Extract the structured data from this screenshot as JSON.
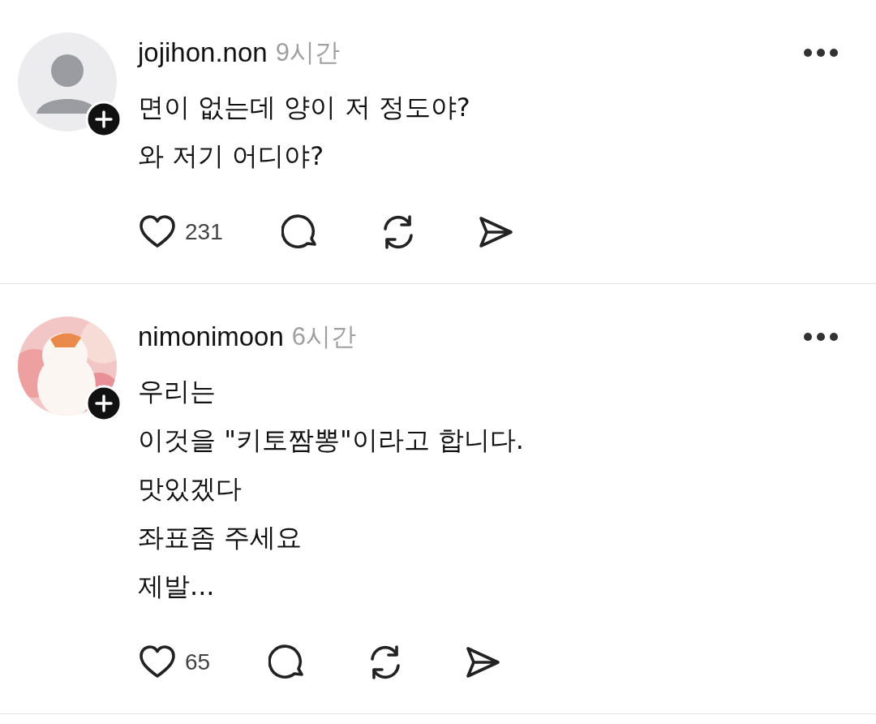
{
  "posts": [
    {
      "username": "jojihon.non",
      "time": "9시간",
      "avatar": {
        "kind": "default"
      },
      "lines": [
        "면이 없는데 양이 저 정도야?",
        "와 저기 어디야?"
      ],
      "likes": "231"
    },
    {
      "username": "nimonimoon",
      "time": "6시간",
      "lines": [
        "우리는",
        "이것을 \"키토짬뽕\"이라고 합니다.",
        "맛있겠다",
        "좌표좀 주세요",
        "제발..."
      ],
      "likes": "65"
    }
  ]
}
